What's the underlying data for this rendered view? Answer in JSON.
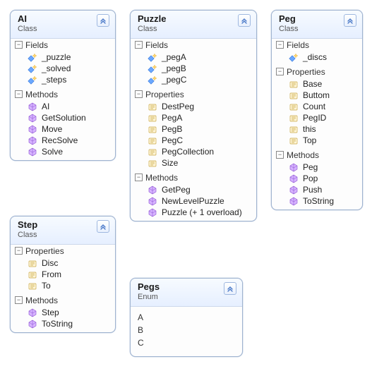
{
  "classes": {
    "ai": {
      "title": "AI",
      "subtitle": "Class",
      "sections": {
        "fields": "Fields",
        "methods": "Methods"
      },
      "fields": [
        {
          "name": "_puzzle",
          "icon": "field"
        },
        {
          "name": "_solved",
          "icon": "field"
        },
        {
          "name": "_steps",
          "icon": "field"
        }
      ],
      "methods": [
        {
          "name": "AI",
          "icon": "method"
        },
        {
          "name": "GetSolution",
          "icon": "method"
        },
        {
          "name": "Move",
          "icon": "method"
        },
        {
          "name": "RecSolve",
          "icon": "method"
        },
        {
          "name": "Solve",
          "icon": "method"
        }
      ]
    },
    "puzzle": {
      "title": "Puzzle",
      "subtitle": "Class",
      "sections": {
        "fields": "Fields",
        "properties": "Properties",
        "methods": "Methods"
      },
      "fields": [
        {
          "name": "_pegA",
          "icon": "field"
        },
        {
          "name": "_pegB",
          "icon": "field"
        },
        {
          "name": "_pegC",
          "icon": "field"
        }
      ],
      "properties": [
        {
          "name": "DestPeg",
          "icon": "property"
        },
        {
          "name": "PegA",
          "icon": "property"
        },
        {
          "name": "PegB",
          "icon": "property"
        },
        {
          "name": "PegC",
          "icon": "property"
        },
        {
          "name": "PegCollection",
          "icon": "property"
        },
        {
          "name": "Size",
          "icon": "property"
        }
      ],
      "methods": [
        {
          "name": "GetPeg",
          "icon": "method"
        },
        {
          "name": "NewLevelPuzzle",
          "icon": "method"
        },
        {
          "name": "Puzzle (+ 1 overload)",
          "icon": "method"
        }
      ]
    },
    "peg": {
      "title": "Peg",
      "subtitle": "Class",
      "sections": {
        "fields": "Fields",
        "properties": "Properties",
        "methods": "Methods"
      },
      "fields": [
        {
          "name": "_discs",
          "icon": "field"
        }
      ],
      "properties": [
        {
          "name": "Base",
          "icon": "property"
        },
        {
          "name": "Buttom",
          "icon": "property"
        },
        {
          "name": "Count",
          "icon": "property"
        },
        {
          "name": "PegID",
          "icon": "property"
        },
        {
          "name": "this",
          "icon": "property"
        },
        {
          "name": "Top",
          "icon": "property"
        }
      ],
      "methods": [
        {
          "name": "Peg",
          "icon": "method"
        },
        {
          "name": "Pop",
          "icon": "method"
        },
        {
          "name": "Push",
          "icon": "method"
        },
        {
          "name": "ToString",
          "icon": "method"
        }
      ]
    },
    "step": {
      "title": "Step",
      "subtitle": "Class",
      "sections": {
        "properties": "Properties",
        "methods": "Methods"
      },
      "properties": [
        {
          "name": "Disc",
          "icon": "property"
        },
        {
          "name": "From",
          "icon": "property"
        },
        {
          "name": "To",
          "icon": "property"
        }
      ],
      "methods": [
        {
          "name": "Step",
          "icon": "method"
        },
        {
          "name": "ToString",
          "icon": "method"
        }
      ]
    },
    "pegs": {
      "title": "Pegs",
      "subtitle": "Enum",
      "values": [
        "A",
        "B",
        "C"
      ]
    }
  },
  "glyphs": {
    "minus": "−"
  }
}
